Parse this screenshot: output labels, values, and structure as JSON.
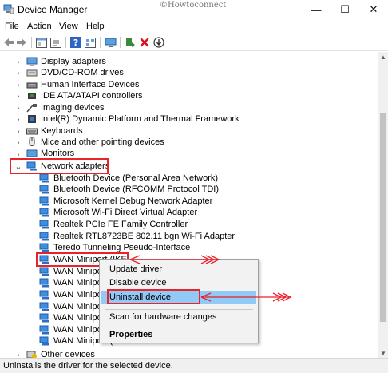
{
  "window": {
    "title": "Device Manager",
    "watermark": "©Howtoconnect",
    "minimize_glyph": "—",
    "maximize_glyph": "☐",
    "close_glyph": "✕"
  },
  "menu": {
    "items": [
      "File",
      "Action",
      "View",
      "Help"
    ]
  },
  "toolbar": {
    "icons": [
      "back-arrow-icon",
      "forward-arrow-icon",
      "show-hide-console-tree-icon",
      "properties-icon",
      "help-icon",
      "view-icon",
      "monitor-icon",
      "update-driver-icon",
      "uninstall-x-icon",
      "scan-hardware-icon"
    ]
  },
  "tree": {
    "categories_top": [
      {
        "label": "Display adapters",
        "icon": "display-adapter-icon"
      },
      {
        "label": "DVD/CD-ROM drives",
        "icon": "dvd-drive-icon"
      },
      {
        "label": "Human Interface Devices",
        "icon": "hid-icon"
      },
      {
        "label": "IDE ATA/ATAPI controllers",
        "icon": "ide-controller-icon"
      },
      {
        "label": "Imaging devices",
        "icon": "camera-icon"
      },
      {
        "label": "Intel(R) Dynamic Platform and Thermal Framework",
        "icon": "chip-icon"
      },
      {
        "label": "Keyboards",
        "icon": "keyboard-icon"
      },
      {
        "label": "Mice and other pointing devices",
        "icon": "mouse-icon"
      },
      {
        "label": "Monitors",
        "icon": "monitor-icon"
      }
    ],
    "network_adapters": {
      "label": "Network adapters",
      "expand_glyph": "⌄",
      "children": [
        "Bluetooth Device (Personal Area Network)",
        "Bluetooth Device (RFCOMM Protocol TDI)",
        "Microsoft Kernel Debug Network Adapter",
        "Microsoft Wi-Fi Direct Virtual Adapter",
        "Realtek PCIe FE Family Controller",
        "Realtek RTL8723BE 802.11 bgn Wi-Fi Adapter",
        "Teredo Tunneling Pseudo-Interface",
        "WAN Miniport (IKEv2)",
        "WAN Miniport (IP)",
        "WAN Miniport (IPv6)",
        "WAN Miniport (L2TP)",
        "WAN Miniport (Network Monitor)",
        "WAN Miniport (PPPOE)",
        "WAN Miniport (PPTP)",
        "WAN Miniport (SSTP)"
      ],
      "visible_labels": [
        "Bluetooth Device (Personal Area Network)",
        "Bluetooth Device (RFCOMM Protocol TDI)",
        "Microsoft Kernel Debug Network Adapter",
        "Microsoft Wi-Fi Direct Virtual Adapter",
        "Realtek PCIe FE Family Controller",
        "Realtek RTL8723BE 802.11 bgn Wi-Fi Adapter",
        "Teredo Tunneling Pseudo-Interface",
        "WAN Miniport (IKEv2)",
        "WAN Miniport (",
        "WAN Miniport (",
        "WAN Miniport (",
        "WAN Miniport (",
        "WAN Miniport (",
        "WAN Miniport (",
        "WAN Miniport ("
      ]
    },
    "categories_bottom": [
      {
        "label": "Other devices",
        "icon": "other-devices-icon"
      }
    ],
    "collapse_glyph": "›"
  },
  "context_menu": {
    "items": [
      "Update driver",
      "Disable device",
      "Uninstall device",
      "Scan for hardware changes",
      "Properties"
    ],
    "selected": "Uninstall device"
  },
  "status": {
    "text": "Uninstalls the driver for the selected device."
  },
  "colors": {
    "highlight": "#e8232a",
    "selection": "#91c9f7",
    "network_icon": "#2f7fd6",
    "accent": "#0078d7"
  }
}
